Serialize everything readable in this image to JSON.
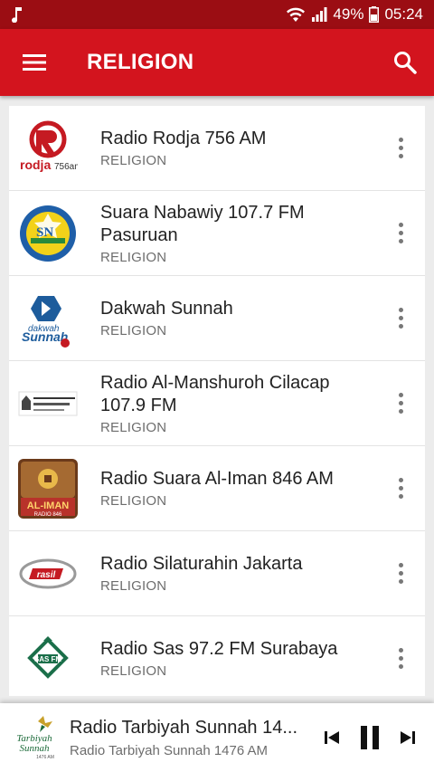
{
  "status": {
    "battery": "49%",
    "time": "05:24",
    "icons": [
      "music-note-icon",
      "wifi-icon",
      "signal-icon",
      "battery-icon"
    ]
  },
  "app_bar": {
    "title": "RELIGION",
    "menu_icon": "hamburger-icon",
    "search_icon": "search-icon"
  },
  "stations": [
    {
      "name": "Radio Rodja 756 AM",
      "genre": "RELIGION"
    },
    {
      "name": "Suara Nabawiy 107.7 FM Pasuruan",
      "genre": "RELIGION"
    },
    {
      "name": "Dakwah Sunnah",
      "genre": "RELIGION"
    },
    {
      "name": "Radio Al-Manshuroh Cilacap 107.9 FM",
      "genre": "RELIGION"
    },
    {
      "name": "Radio Suara Al-Iman 846 AM",
      "genre": "RELIGION"
    },
    {
      "name": "Radio Silaturahin Jakarta",
      "genre": "RELIGION"
    },
    {
      "name": "Radio Sas 97.2 FM Surabaya",
      "genre": "RELIGION"
    }
  ],
  "player": {
    "title": "Radio Tarbiyah Sunnah 14...",
    "subtitle": "Radio Tarbiyah Sunnah 1476 AM",
    "logo_text": "Tarbiyah Sunnah",
    "controls": [
      "skip-previous-icon",
      "pause-icon",
      "skip-next-icon"
    ]
  },
  "colors": {
    "status_bar": "#9b0d13",
    "app_bar": "#d3141e",
    "background": "#ececec"
  }
}
